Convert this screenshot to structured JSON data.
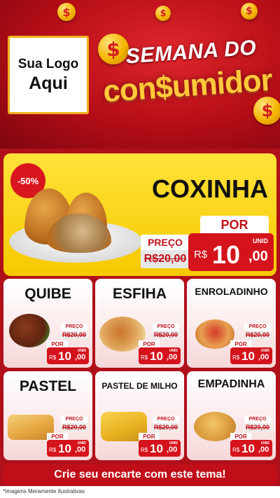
{
  "header": {
    "logo_line1": "Sua Logo",
    "logo_line2": "Aqui",
    "title_top": "SEMANA DO",
    "title_bottom": "con$umidor",
    "coin_glyph": "$"
  },
  "featured": {
    "discount_badge": "-50%",
    "name": "COXINHA",
    "old_price_label": "PREÇO",
    "old_price": "R$20,00",
    "por_label": "POR",
    "unid_label": "UNID",
    "currency": "R$",
    "price_int": "10",
    "price_dec": ",00"
  },
  "products": [
    {
      "name": "QUIBE",
      "old_price_label": "PREÇO",
      "old_price": "R$20,00",
      "por_label": "POR",
      "unid_label": "UNID",
      "currency": "R$",
      "price_int": "10",
      "price_dec": ",00"
    },
    {
      "name": "ESFIHA",
      "old_price_label": "PREÇO",
      "old_price": "R$20,00",
      "por_label": "POR",
      "unid_label": "UNID",
      "currency": "R$",
      "price_int": "10",
      "price_dec": ",00"
    },
    {
      "name": "ENROLADINHO",
      "old_price_label": "PREÇO",
      "old_price": "R$20,00",
      "por_label": "POR",
      "unid_label": "UNID",
      "currency": "R$",
      "price_int": "10",
      "price_dec": ",00"
    },
    {
      "name": "PASTEL",
      "old_price_label": "PREÇO",
      "old_price": "R$20,00",
      "por_label": "POR",
      "unid_label": "UNID",
      "currency": "R$",
      "price_int": "10",
      "price_dec": ",00"
    },
    {
      "name": "PASTEL DE MILHO",
      "old_price_label": "PREÇO",
      "old_price": "R$20,00",
      "por_label": "POR",
      "unid_label": "UNID",
      "currency": "R$",
      "price_int": "10",
      "price_dec": ",00"
    },
    {
      "name": "EMPADINHA",
      "old_price_label": "PREÇO",
      "old_price": "R$20,00",
      "por_label": "POR",
      "unid_label": "UNID",
      "currency": "R$",
      "price_int": "10",
      "price_dec": ",00"
    }
  ],
  "cta": "Crie seu encarte com este tema!",
  "disclaimer": "*Imagens Meramente Ilustrativas",
  "colors": {
    "red": "#d4131c",
    "yellow": "#ffe23a",
    "gold": "#f4b400"
  }
}
